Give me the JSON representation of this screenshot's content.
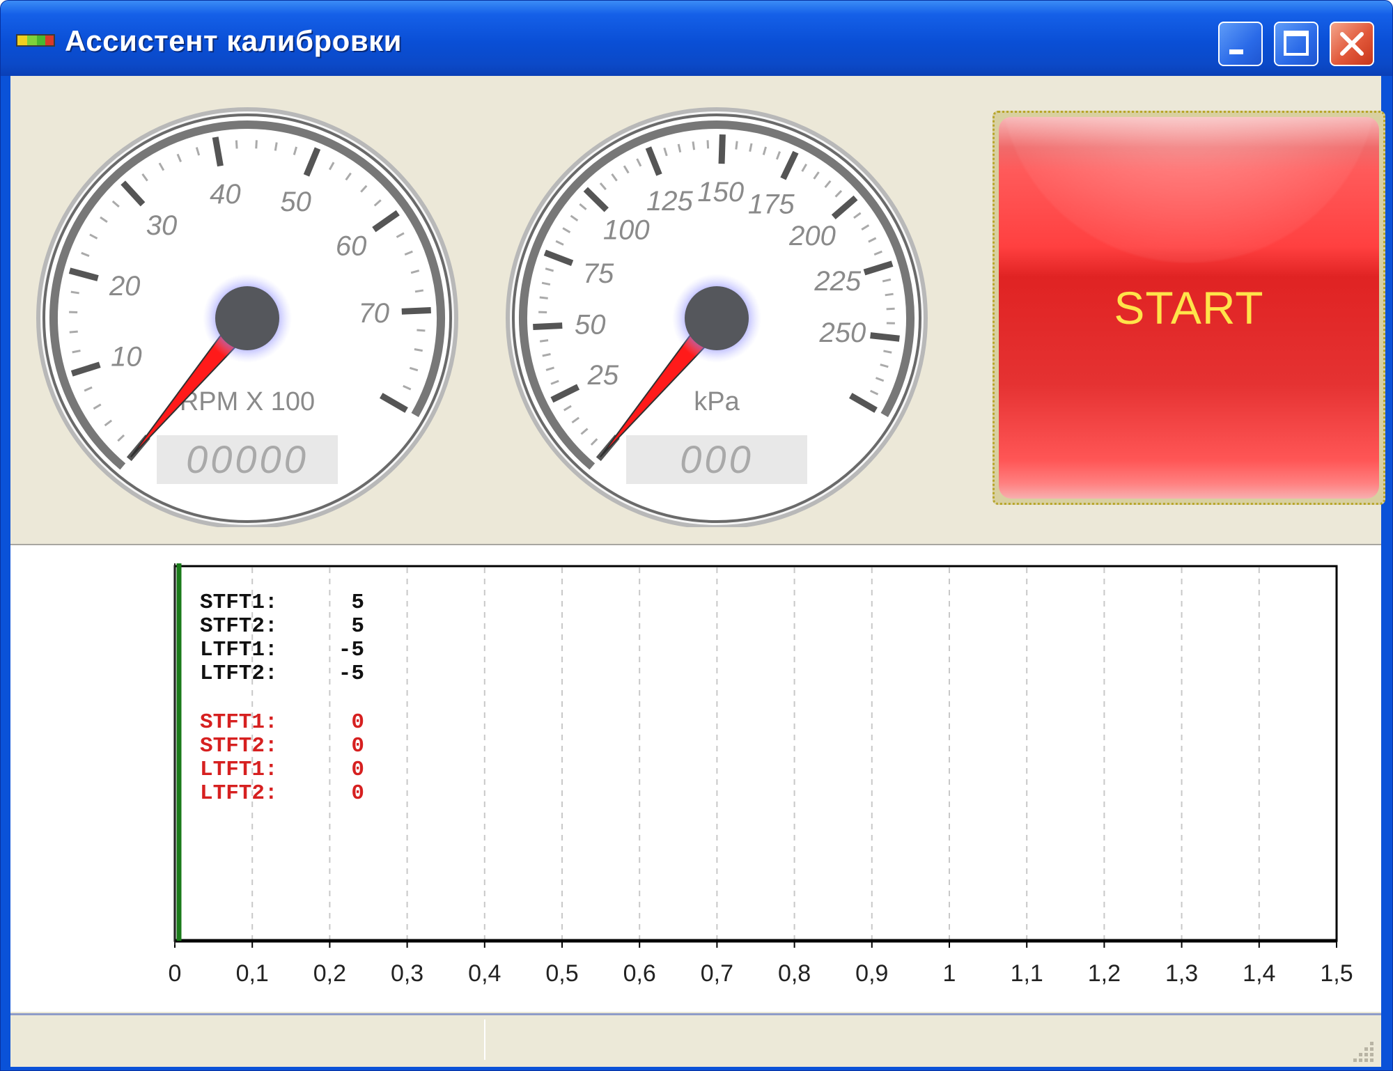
{
  "window": {
    "title": "Ассистент калибровки",
    "controls": {
      "minimize": "minimize",
      "maximize": "maximize",
      "close": "close"
    }
  },
  "gauges": [
    {
      "id": "rpm",
      "unit_label": "RPM X 100",
      "tick_labels": [
        "10",
        "20",
        "30",
        "40",
        "50",
        "60",
        "70"
      ],
      "tick_values": [
        10,
        20,
        30,
        40,
        50,
        60,
        70
      ],
      "min": 0,
      "max": 80,
      "digital_readout": "00000",
      "needle_value": 0
    },
    {
      "id": "map",
      "unit_label": "kPa",
      "tick_labels": [
        "25",
        "50",
        "75",
        "100",
        "125",
        "150",
        "175",
        "200",
        "225",
        "250"
      ],
      "tick_values": [
        25,
        50,
        75,
        100,
        125,
        150,
        175,
        200,
        225,
        250
      ],
      "min": 0,
      "max": 275,
      "digital_readout": "000",
      "needle_value": 0
    }
  ],
  "start_button": {
    "label": "START"
  },
  "trims_current": [
    {
      "name": "STFT1:",
      "value": "5"
    },
    {
      "name": "STFT2:",
      "value": "5"
    },
    {
      "name": "LTFT1:",
      "value": "-5"
    },
    {
      "name": "LTFT2:",
      "value": "-5"
    }
  ],
  "trims_target": [
    {
      "name": "STFT1:",
      "value": "0"
    },
    {
      "name": "STFT2:",
      "value": "0"
    },
    {
      "name": "LTFT1:",
      "value": "0"
    },
    {
      "name": "LTFT2:",
      "value": "0"
    }
  ],
  "chart_data": {
    "type": "line",
    "x_ticks": [
      "0",
      "0,1",
      "0,2",
      "0,3",
      "0,4",
      "0,5",
      "0,6",
      "0,7",
      "0,8",
      "0,9",
      "1",
      "1,1",
      "1,2",
      "1,3",
      "1,4",
      "1,5"
    ],
    "xlim": [
      0,
      1.5
    ],
    "grid": true,
    "series": []
  },
  "colors": {
    "needle": "#ff1a1a",
    "start_text": "#ffe44a",
    "trim_current": "#111111",
    "trim_target": "#d62020",
    "chart_left_axis": "#1a7a1a"
  }
}
